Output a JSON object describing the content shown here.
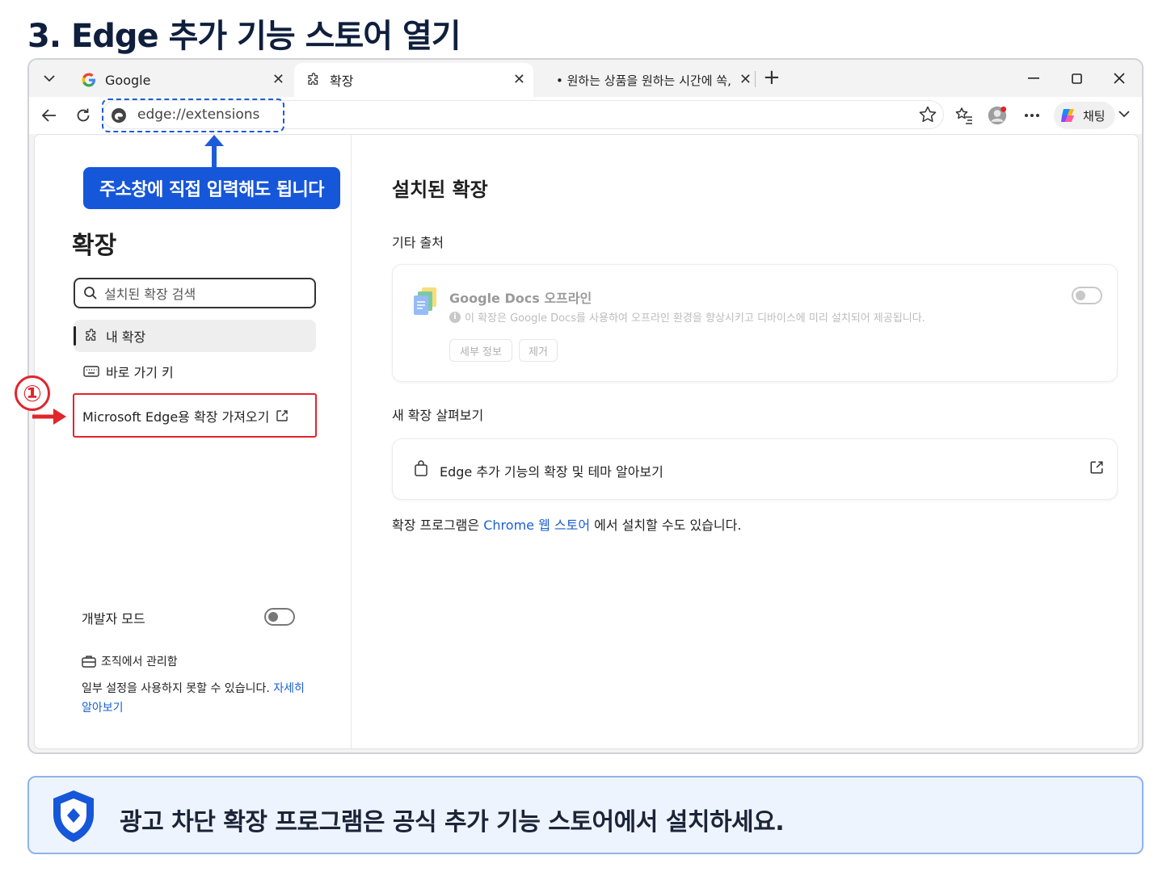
{
  "heading": "3. Edge 추가 기능 스토어 열기",
  "browser": {
    "tabs": [
      {
        "label": "Google",
        "icon": "google-icon"
      },
      {
        "label": "확장",
        "icon": "puzzle-icon"
      },
      {
        "label": "• 원하는 상품을 원하는 시간에 쏙,",
        "icon": "none"
      }
    ],
    "address": "edge://extensions",
    "copilot_label": "채팅"
  },
  "callout": "주소창에 직접 입력해도 됩니다",
  "sidebar": {
    "title": "확장",
    "search_placeholder": "설치된 확장 검색",
    "items": [
      {
        "label": "내 확장",
        "icon": "puzzle-icon",
        "selected": true
      },
      {
        "label": "바로 가기 키",
        "icon": "keyboard-icon",
        "selected": false
      }
    ],
    "get_extensions": "Microsoft Edge용 확장 가져오기",
    "dev_mode_label": "개발자 모드",
    "dev_mode_on": false,
    "org_label": "조직에서 관리함",
    "org_desc": "일부 설정을 사용하지 못할 수 있습니다.",
    "org_link": "자세히 알아보기"
  },
  "main": {
    "title": "설치된 확장",
    "other_sources": "기타 출처",
    "extension": {
      "name": "Google Docs 오프라인",
      "description": "이 확장은 Google Docs를 사용하여 오프라인 환경을 향상시키고 디바이스에 미리 설치되어 제공됩니다.",
      "details_button": "세부 정보",
      "remove_button": "제거",
      "enabled": false
    },
    "discover_title": "새 확장 살펴보기",
    "discover_link": "Edge 추가 기능의 확장 및 테마 알아보기",
    "chrome_prefix": "확장 프로그램은",
    "chrome_link": "Chrome 웹 스토어",
    "chrome_suffix": "에서 설치할 수도 있습니다."
  },
  "step_marker": "①",
  "banner": "광고 차단 확장 프로그램은 공식 추가 기능 스토어에서 설치하세요.",
  "colors": {
    "accent": "#1656d9",
    "highlight_red": "#e0252b",
    "link": "#1a5fd0"
  }
}
